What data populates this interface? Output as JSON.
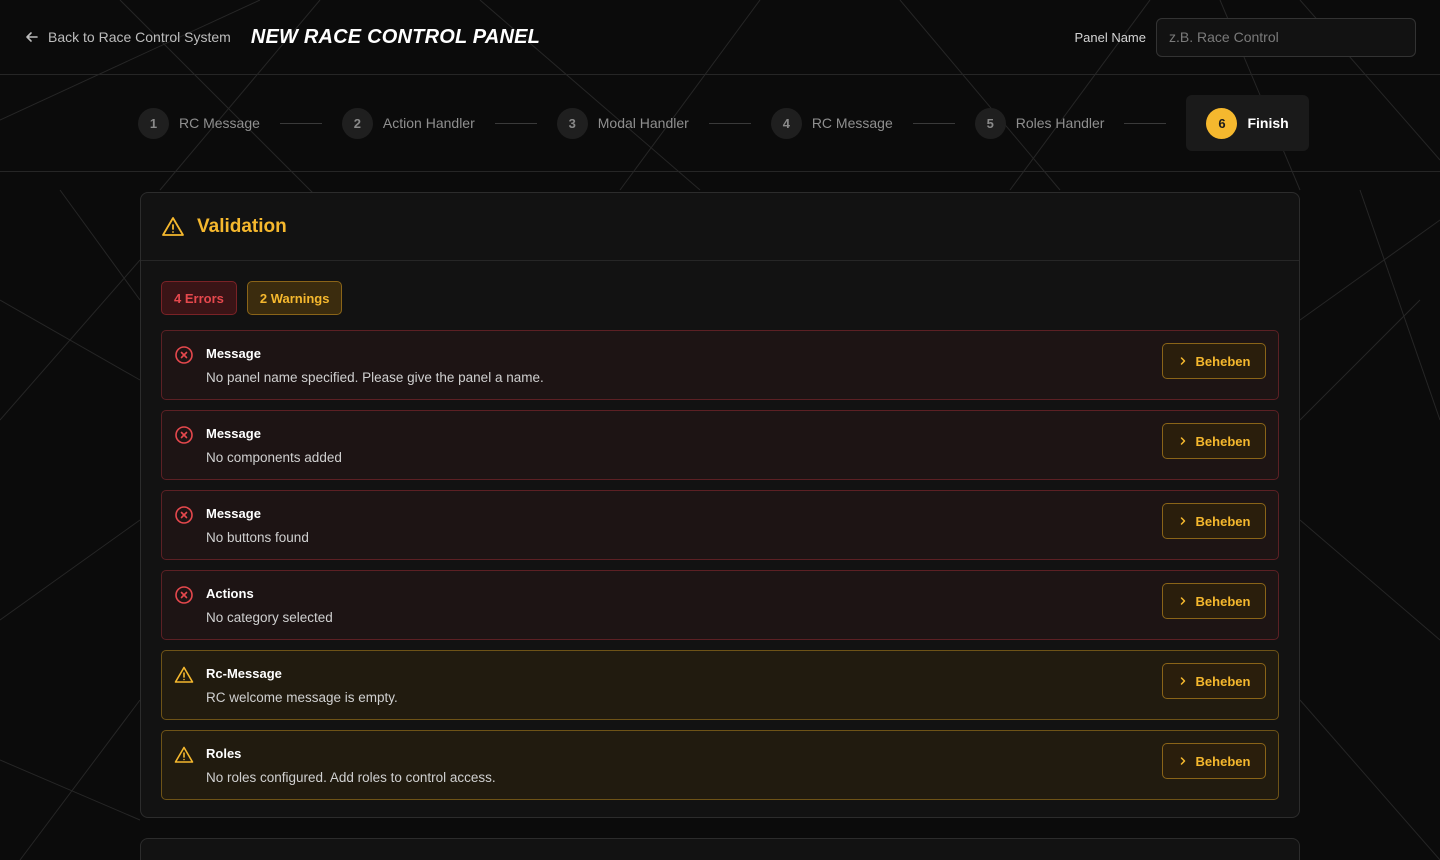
{
  "header": {
    "back_label": "Back to Race Control System",
    "title": "NEW RACE CONTROL PANEL",
    "panel_name_label": "Panel Name",
    "panel_name_placeholder": "z.B. Race Control",
    "panel_name_value": ""
  },
  "steps": [
    {
      "num": "1",
      "label": "RC Message"
    },
    {
      "num": "2",
      "label": "Action Handler"
    },
    {
      "num": "3",
      "label": "Modal Handler"
    },
    {
      "num": "4",
      "label": "RC Message"
    },
    {
      "num": "5",
      "label": "Roles Handler"
    },
    {
      "num": "6",
      "label": "Finish",
      "active": true
    }
  ],
  "validation": {
    "title": "Validation",
    "errors_badge": "4 Errors",
    "warnings_badge": "2 Warnings",
    "fix_label": "Beheben",
    "issues": [
      {
        "type": "error",
        "title": "Message",
        "desc": "No panel name specified. Please give the panel a name."
      },
      {
        "type": "error",
        "title": "Message",
        "desc": "No components added"
      },
      {
        "type": "error",
        "title": "Message",
        "desc": "No buttons found"
      },
      {
        "type": "error",
        "title": "Actions",
        "desc": "No category selected"
      },
      {
        "type": "warning",
        "title": "Rc-Message",
        "desc": "RC welcome message is empty."
      },
      {
        "type": "warning",
        "title": "Roles",
        "desc": "No roles configured. Add roles to control access."
      }
    ]
  },
  "colors": {
    "accent": "#f5b82e",
    "error": "#e5484d",
    "background": "#0b0b0b"
  },
  "icons": {
    "back": "arrow-left-icon",
    "warning": "warning-triangle-icon",
    "error": "x-circle-icon",
    "fix": "chevron-right-icon"
  }
}
